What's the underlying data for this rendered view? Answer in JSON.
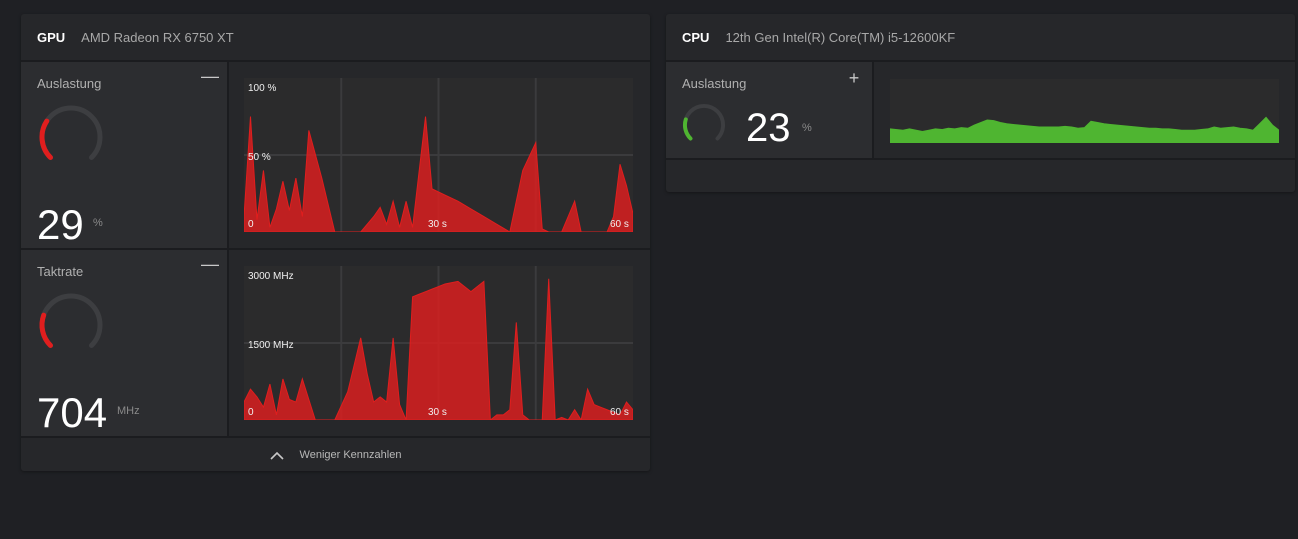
{
  "gpu": {
    "kind": "GPU",
    "model": "AMD Radeon RX 6750 XT",
    "usage": {
      "label": "Auslastung",
      "value": "29",
      "unit": "%",
      "level": 0.29,
      "collapse_symbol": "—",
      "chart_labels": {
        "top": "100 %",
        "mid": "50 %",
        "x_start": "0",
        "x_mid": "30 s",
        "x_end": "60 s"
      }
    },
    "clock": {
      "label": "Taktrate",
      "value": "704",
      "unit": "MHz",
      "level": 0.24,
      "collapse_symbol": "—",
      "chart_labels": {
        "top": "3000 MHz",
        "mid": "1500 MHz",
        "x_start": "0",
        "x_mid": "30 s",
        "x_end": "60 s"
      }
    },
    "footer_label": "Weniger Kennzahlen"
  },
  "cpu": {
    "kind": "CPU",
    "model": "12th Gen Intel(R) Core(TM) i5-12600KF",
    "usage": {
      "label": "Auslastung",
      "value": "23",
      "unit": "%",
      "level": 0.23,
      "expand_symbol": "+"
    }
  },
  "colors": {
    "gpu_accent": "#e01e1e",
    "cpu_accent": "#4fb531",
    "gauge_track": "#3d3e41"
  },
  "chart_data": [
    {
      "type": "area",
      "title": "",
      "unit": "%",
      "ylim": [
        0,
        100
      ],
      "xlim": [
        0,
        60
      ],
      "x": [
        0,
        1,
        2,
        3,
        4,
        5,
        6,
        7,
        8,
        9,
        10,
        12,
        14,
        16,
        18,
        20,
        21,
        22,
        23,
        24,
        25,
        26,
        28,
        29,
        31,
        33,
        35,
        37,
        39,
        41,
        43,
        45,
        46,
        47,
        49,
        51,
        52,
        53,
        55,
        56,
        57,
        58,
        59,
        60
      ],
      "values": [
        10,
        75,
        8,
        40,
        3,
        15,
        33,
        14,
        35,
        10,
        66,
        35,
        0,
        0,
        0,
        10,
        16,
        5,
        20,
        3,
        20,
        3,
        75,
        28,
        24,
        20,
        15,
        10,
        5,
        0,
        40,
        58,
        2,
        0,
        0,
        20,
        0,
        0,
        0,
        0,
        10,
        44,
        30,
        12
      ]
    },
    {
      "type": "area",
      "title": "",
      "unit": "MHz",
      "ylim": [
        0,
        3000
      ],
      "xlim": [
        0,
        60
      ],
      "x": [
        0,
        1,
        2,
        3,
        4,
        5,
        6,
        7,
        8,
        9,
        10,
        11,
        12,
        14,
        16,
        18,
        19,
        20,
        21,
        22,
        23,
        24,
        25,
        26,
        27,
        28,
        29,
        30,
        31,
        33,
        35,
        37,
        38,
        39,
        40,
        41,
        42,
        43,
        44,
        45,
        46,
        47,
        48,
        49,
        50,
        51,
        52,
        53,
        54,
        55,
        56,
        57,
        58,
        59,
        60
      ],
      "values": [
        350,
        600,
        450,
        250,
        700,
        100,
        800,
        400,
        350,
        800,
        400,
        0,
        0,
        0,
        550,
        1600,
        900,
        350,
        450,
        350,
        1600,
        300,
        0,
        2400,
        2450,
        2500,
        2550,
        2600,
        2650,
        2700,
        2500,
        2700,
        0,
        100,
        100,
        200,
        1900,
        100,
        0,
        0,
        0,
        2750,
        0,
        50,
        0,
        200,
        0,
        600,
        300,
        250,
        200,
        150,
        100,
        350,
        200
      ]
    },
    {
      "type": "area",
      "title": "",
      "unit": "%",
      "ylim": [
        0,
        100
      ],
      "xlim": [
        0,
        60
      ],
      "x": [
        0,
        2,
        3,
        5,
        6,
        7,
        8,
        9,
        10,
        11,
        12,
        13,
        15,
        16,
        17,
        18,
        19,
        20,
        21,
        22,
        23,
        24,
        25,
        26,
        27,
        28,
        29,
        30,
        31,
        32,
        33,
        34,
        35,
        36,
        37,
        38,
        39,
        40,
        41,
        42,
        43,
        44,
        45,
        46,
        47,
        48,
        49,
        50,
        51,
        52,
        53,
        54,
        55,
        56,
        57,
        58,
        59,
        60
      ],
      "values": [
        22,
        20,
        22,
        18,
        20,
        22,
        21,
        23,
        22,
        24,
        23,
        28,
        36,
        35,
        32,
        30,
        29,
        28,
        27,
        26,
        25,
        25,
        25,
        25,
        26,
        25,
        23,
        24,
        34,
        32,
        30,
        29,
        28,
        27,
        26,
        25,
        24,
        23,
        23,
        22,
        22,
        21,
        20,
        20,
        20,
        21,
        22,
        25,
        23,
        24,
        25,
        23,
        22,
        20,
        30,
        40,
        28,
        20
      ]
    }
  ]
}
